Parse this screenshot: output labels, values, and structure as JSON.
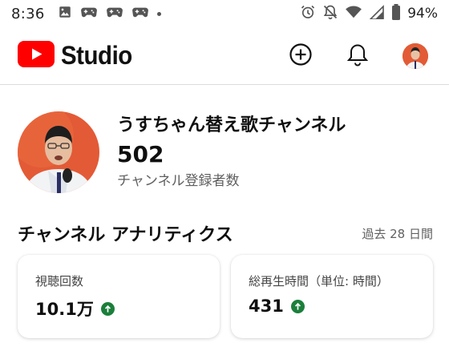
{
  "status_bar": {
    "time": "8:36",
    "battery": "94%"
  },
  "app": {
    "name": "Studio",
    "accent": "#ff0000"
  },
  "channel": {
    "name": "うすちゃん替え歌チャンネル",
    "subscribers": "502",
    "subscribers_label": "チャンネル登録者数"
  },
  "analytics": {
    "title": "チャンネル アナリティクス",
    "period": "過去 28 日間",
    "cards": [
      {
        "label": "視聴回数",
        "value": "10.1万",
        "trend": "up"
      },
      {
        "label": "総再生時間（単位: 時間）",
        "value": "431",
        "trend": "up"
      }
    ],
    "trend_color": "#1b7f3b"
  },
  "icons": {
    "create": "plus-circle-icon",
    "notifications": "bell-icon",
    "account": "avatar"
  }
}
